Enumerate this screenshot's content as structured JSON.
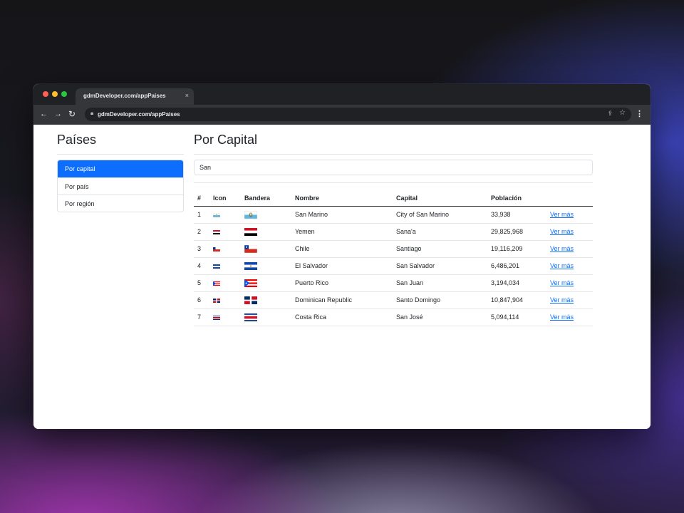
{
  "browser": {
    "tab_title": "gdmDeveloper.com/appPaises",
    "tab_close": "×",
    "url": "gdmDeveloper.com/appPaises",
    "icons": [
      "back-arrow-icon",
      "forward-arrow-icon",
      "reload-icon",
      "lock-icon",
      "share-icon",
      "star-icon",
      "more-menu-icon"
    ]
  },
  "sidebar": {
    "title": "Países",
    "items": [
      {
        "label": "Por capital",
        "active": true
      },
      {
        "label": "Por país",
        "active": false
      },
      {
        "label": "Por región",
        "active": false
      }
    ]
  },
  "main": {
    "title": "Por Capital",
    "search_value": "San",
    "table": {
      "headers": [
        "#",
        "Icon",
        "Bandera",
        "Nombre",
        "Capital",
        "Población"
      ],
      "rows": [
        {
          "num": "1",
          "flag": "san-marino-flag",
          "name": "San Marino",
          "capital": "City of San Marino",
          "population": "33,938",
          "link": "Ver más"
        },
        {
          "num": "2",
          "flag": "yemen-flag",
          "name": "Yemen",
          "capital": "Sana'a",
          "population": "29,825,968",
          "link": "Ver más"
        },
        {
          "num": "3",
          "flag": "chile-flag",
          "name": "Chile",
          "capital": "Santiago",
          "population": "19,116,209",
          "link": "Ver más"
        },
        {
          "num": "4",
          "flag": "el-salvador-flag",
          "name": "El Salvador",
          "capital": "San Salvador",
          "population": "6,486,201",
          "link": "Ver más"
        },
        {
          "num": "5",
          "flag": "puerto-rico-flag",
          "name": "Puerto Rico",
          "capital": "San Juan",
          "population": "3,194,034",
          "link": "Ver más"
        },
        {
          "num": "6",
          "flag": "dominican-republic-flag",
          "name": "Dominican Republic",
          "capital": "Santo Domingo",
          "population": "10,847,904",
          "link": "Ver más"
        },
        {
          "num": "7",
          "flag": "costa-rica-flag",
          "name": "Costa Rica",
          "capital": "San José",
          "population": "5,094,114",
          "link": "Ver más"
        }
      ]
    }
  },
  "colors": {
    "accent": "#0d6efd",
    "link": "#0d6efd",
    "browser_dark": "#202124"
  }
}
